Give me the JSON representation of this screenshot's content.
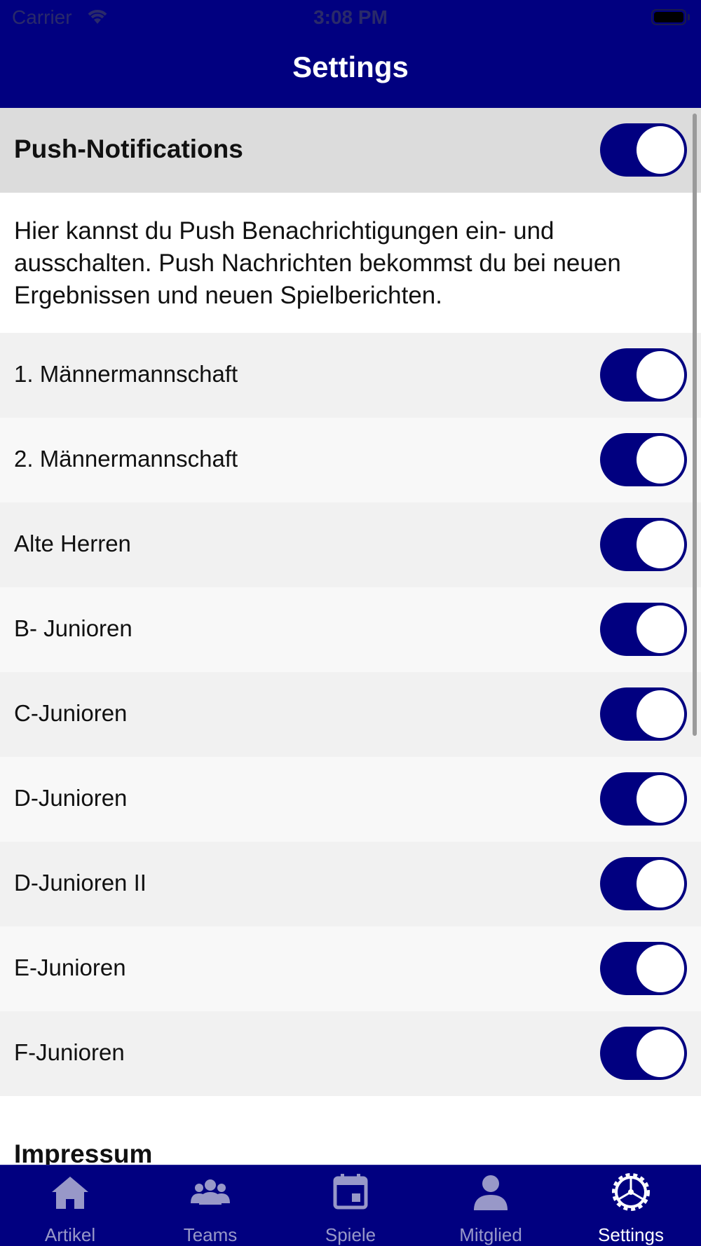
{
  "status_bar": {
    "carrier": "Carrier",
    "time": "3:08 PM"
  },
  "nav": {
    "title": "Settings"
  },
  "push_section": {
    "label": "Push-Notifications",
    "enabled": true,
    "description": "Hier kannst du Push Benachrichtigungen ein- und ausschalten. Push Nachrichten bekommst du bei neuen Ergebnissen und neuen Spielberichten."
  },
  "teams": [
    {
      "label": "1. Männermannschaft",
      "enabled": true
    },
    {
      "label": "2. Männermannschaft",
      "enabled": true
    },
    {
      "label": "Alte Herren",
      "enabled": true
    },
    {
      "label": "B- Junioren",
      "enabled": true
    },
    {
      "label": "C-Junioren",
      "enabled": true
    },
    {
      "label": "D-Junioren",
      "enabled": true
    },
    {
      "label": "D-Junioren II",
      "enabled": true
    },
    {
      "label": "E-Junioren",
      "enabled": true
    },
    {
      "label": "F-Junioren",
      "enabled": true
    }
  ],
  "impressum": {
    "label": "Impressum"
  },
  "tabbar": {
    "tabs": [
      {
        "label": "Artikel",
        "icon": "house-icon",
        "active": false
      },
      {
        "label": "Teams",
        "icon": "people-icon",
        "active": false
      },
      {
        "label": "Spiele",
        "icon": "calendar-icon",
        "active": false
      },
      {
        "label": "Mitglied",
        "icon": "person-icon",
        "active": false
      },
      {
        "label": "Settings",
        "icon": "gear-icon",
        "active": true
      }
    ]
  },
  "colors": {
    "accent": "#010080",
    "inactive_tab": "#9898c8",
    "active_tab": "#ffffff"
  }
}
